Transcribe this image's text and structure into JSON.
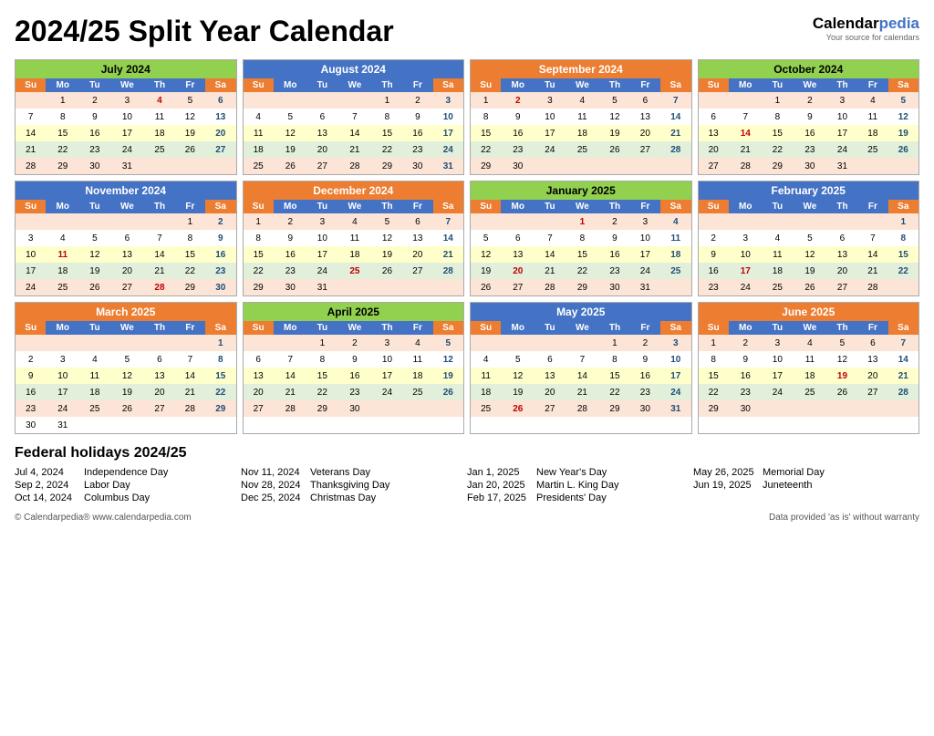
{
  "title": "2024/25 Split Year Calendar",
  "brand": {
    "name1": "Calendar",
    "name2": "pedia",
    "tagline": "Your source for calendars"
  },
  "months": [
    {
      "name": "July 2024",
      "headerClass": "green",
      "days": [
        [
          "",
          "1",
          "2",
          "3",
          "4*",
          "5",
          "6"
        ],
        [
          "7",
          "8",
          "9",
          "10",
          "11",
          "12",
          "13"
        ],
        [
          "14",
          "15",
          "16",
          "17",
          "18",
          "19",
          "20"
        ],
        [
          "21",
          "22",
          "23",
          "24",
          "25",
          "26",
          "27"
        ],
        [
          "28",
          "29",
          "30",
          "31",
          "",
          "",
          ""
        ]
      ],
      "redDays": [
        [
          "row0",
          "col4"
        ]
      ]
    },
    {
      "name": "August 2024",
      "headerClass": "blue",
      "days": [
        [
          "",
          "",
          "",
          "",
          "1",
          "2",
          "3"
        ],
        [
          "4",
          "5",
          "6",
          "7",
          "8",
          "9",
          "10"
        ],
        [
          "11",
          "12",
          "13",
          "14",
          "15",
          "16",
          "17"
        ],
        [
          "18",
          "19",
          "20",
          "21",
          "22",
          "23",
          "24"
        ],
        [
          "25",
          "26",
          "27",
          "28",
          "29",
          "30",
          "31"
        ]
      ],
      "redDays": []
    },
    {
      "name": "September 2024",
      "headerClass": "orange",
      "days": [
        [
          "1",
          "2*",
          "3",
          "4",
          "5",
          "6",
          "7"
        ],
        [
          "8",
          "9",
          "10",
          "11",
          "12",
          "13",
          "14"
        ],
        [
          "15",
          "16",
          "17",
          "18",
          "19",
          "20",
          "21"
        ],
        [
          "22",
          "23",
          "24",
          "25",
          "26",
          "27",
          "28"
        ],
        [
          "29",
          "30",
          "",
          "",
          "",
          "",
          ""
        ]
      ],
      "redDays": [
        [
          "row0",
          "col1"
        ]
      ]
    },
    {
      "name": "October 2024",
      "headerClass": "green",
      "days": [
        [
          "",
          "",
          "1",
          "2",
          "3",
          "4",
          "5"
        ],
        [
          "6",
          "7",
          "8",
          "9",
          "10",
          "11",
          "12"
        ],
        [
          "13",
          "14*",
          "15",
          "16",
          "17",
          "18",
          "19"
        ],
        [
          "20",
          "21",
          "22",
          "23",
          "24",
          "25",
          "26"
        ],
        [
          "27",
          "28",
          "29",
          "30",
          "31",
          "",
          ""
        ]
      ],
      "redDays": [
        [
          "row2",
          "col1"
        ]
      ]
    },
    {
      "name": "November 2024",
      "headerClass": "blue",
      "days": [
        [
          "",
          "",
          "",
          "",
          "",
          "1",
          "2"
        ],
        [
          "3",
          "4",
          "5",
          "6",
          "7",
          "8",
          "9"
        ],
        [
          "10",
          "11*",
          "12",
          "13",
          "14",
          "15",
          "16"
        ],
        [
          "17",
          "18",
          "19",
          "20",
          "21",
          "22",
          "23"
        ],
        [
          "24",
          "25",
          "26",
          "27",
          "28*",
          "29",
          "30"
        ]
      ],
      "redDays": [
        [
          "row2",
          "col1"
        ],
        [
          "row4",
          "col4"
        ]
      ]
    },
    {
      "name": "December 2024",
      "headerClass": "orange",
      "days": [
        [
          "1",
          "2",
          "3",
          "4",
          "5",
          "6",
          "7"
        ],
        [
          "8",
          "9",
          "10",
          "11",
          "12",
          "13",
          "14"
        ],
        [
          "15",
          "16",
          "17",
          "18",
          "19",
          "20",
          "21"
        ],
        [
          "22",
          "23",
          "24",
          "25*",
          "26",
          "27",
          "28"
        ],
        [
          "29",
          "30",
          "31",
          "",
          "",
          "",
          ""
        ]
      ],
      "redDays": [
        [
          "row3",
          "col3"
        ]
      ]
    },
    {
      "name": "January 2025",
      "headerClass": "green",
      "days": [
        [
          "",
          "",
          "",
          "1*",
          "2",
          "3",
          "4"
        ],
        [
          "5",
          "6",
          "7",
          "8",
          "9",
          "10",
          "11"
        ],
        [
          "12",
          "13",
          "14",
          "15",
          "16",
          "17",
          "18"
        ],
        [
          "19",
          "20*",
          "21",
          "22",
          "23",
          "24",
          "25"
        ],
        [
          "26",
          "27",
          "28",
          "29",
          "30",
          "31",
          ""
        ]
      ],
      "redDays": [
        [
          "row0",
          "col3"
        ],
        [
          "row3",
          "col1"
        ]
      ]
    },
    {
      "name": "February 2025",
      "headerClass": "blue",
      "days": [
        [
          "",
          "",
          "",
          "",
          "",
          "",
          "1"
        ],
        [
          "2",
          "3",
          "4",
          "5",
          "6",
          "7",
          "8"
        ],
        [
          "9",
          "10",
          "11",
          "12",
          "13",
          "14",
          "15"
        ],
        [
          "16",
          "17*",
          "18",
          "19",
          "20",
          "21",
          "22"
        ],
        [
          "23",
          "24",
          "25",
          "26",
          "27",
          "28",
          ""
        ]
      ],
      "redDays": [
        [
          "row3",
          "col1"
        ]
      ]
    },
    {
      "name": "March 2025",
      "headerClass": "orange",
      "days": [
        [
          "",
          "",
          "",
          "",
          "",
          "",
          "1"
        ],
        [
          "2",
          "3",
          "4",
          "5",
          "6",
          "7",
          "8"
        ],
        [
          "9",
          "10",
          "11",
          "12",
          "13",
          "14",
          "15"
        ],
        [
          "16",
          "17",
          "18",
          "19",
          "20",
          "21",
          "22"
        ],
        [
          "23",
          "24",
          "25",
          "26",
          "27",
          "28",
          "29"
        ],
        [
          "30",
          "31",
          "",
          "",
          "",
          "",
          ""
        ]
      ],
      "redDays": []
    },
    {
      "name": "April 2025",
      "headerClass": "green",
      "days": [
        [
          "",
          "",
          "1",
          "2",
          "3",
          "4",
          "5"
        ],
        [
          "6",
          "7",
          "8",
          "9",
          "10",
          "11",
          "12"
        ],
        [
          "13",
          "14",
          "15",
          "16",
          "17",
          "18",
          "19"
        ],
        [
          "20",
          "21",
          "22",
          "23",
          "24",
          "25",
          "26"
        ],
        [
          "27",
          "28",
          "29",
          "30",
          "",
          "",
          ""
        ]
      ],
      "redDays": []
    },
    {
      "name": "May 2025",
      "headerClass": "blue",
      "days": [
        [
          "",
          "",
          "",
          "",
          "1",
          "2",
          "3"
        ],
        [
          "4",
          "5",
          "6",
          "7",
          "8",
          "9",
          "10"
        ],
        [
          "11",
          "12",
          "13",
          "14",
          "15",
          "16",
          "17"
        ],
        [
          "18",
          "19",
          "20",
          "21",
          "22",
          "23",
          "24"
        ],
        [
          "25",
          "26*",
          "27",
          "28",
          "29",
          "30",
          "31"
        ]
      ],
      "redDays": [
        [
          "row4",
          "col1"
        ]
      ]
    },
    {
      "name": "June 2025",
      "headerClass": "orange",
      "days": [
        [
          "1",
          "2",
          "3",
          "4",
          "5",
          "6",
          "7"
        ],
        [
          "8",
          "9",
          "10",
          "11",
          "12",
          "13",
          "14"
        ],
        [
          "15",
          "16",
          "17",
          "18",
          "19*",
          "20",
          "21"
        ],
        [
          "22",
          "23",
          "24",
          "25",
          "26",
          "27",
          "28"
        ],
        [
          "29",
          "30",
          "",
          "",
          "",
          "",
          ""
        ]
      ],
      "redDays": [
        [
          "row2",
          "col4"
        ]
      ]
    }
  ],
  "holidays": {
    "title": "Federal holidays 2024/25",
    "columns": [
      [
        {
          "date": "Jul 4, 2024",
          "name": "Independence Day"
        },
        {
          "date": "Sep 2, 2024",
          "name": "Labor Day"
        },
        {
          "date": "Oct 14, 2024",
          "name": "Columbus Day"
        }
      ],
      [
        {
          "date": "Nov 11, 2024",
          "name": "Veterans Day"
        },
        {
          "date": "Nov 28, 2024",
          "name": "Thanksgiving Day"
        },
        {
          "date": "Dec 25, 2024",
          "name": "Christmas Day"
        }
      ],
      [
        {
          "date": "Jan 1, 2025",
          "name": "New Year's Day"
        },
        {
          "date": "Jan 20, 2025",
          "name": "Martin L. King Day"
        },
        {
          "date": "Feb 17, 2025",
          "name": "Presidents' Day"
        }
      ],
      [
        {
          "date": "May 26, 2025",
          "name": "Memorial Day"
        },
        {
          "date": "Jun 19, 2025",
          "name": "Juneteenth"
        },
        {
          "date": "",
          "name": ""
        }
      ]
    ]
  },
  "footer": {
    "left": "© Calendarpedia®   www.calendarpedia.com",
    "right": "Data provided 'as is' without warranty"
  }
}
